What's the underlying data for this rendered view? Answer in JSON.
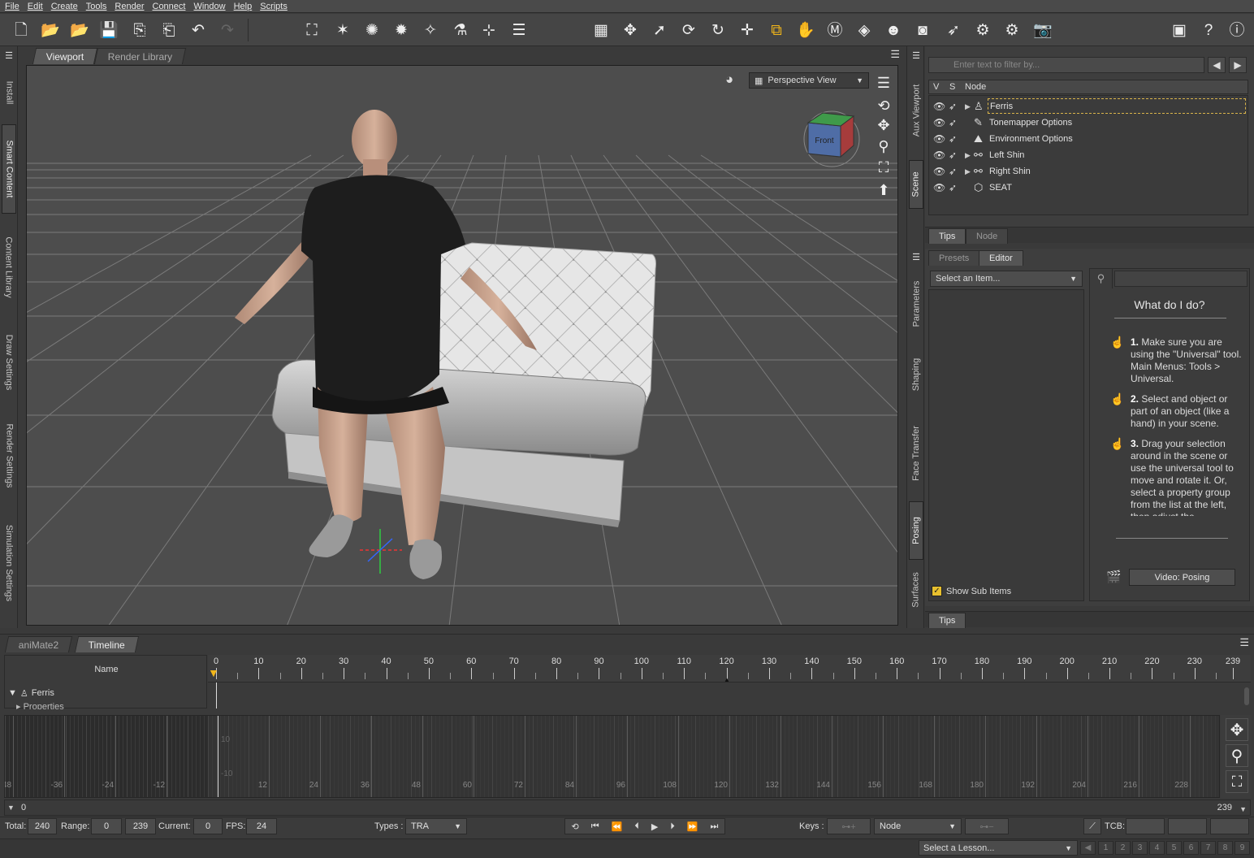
{
  "menubar": {
    "items": [
      "File",
      "Edit",
      "Create",
      "Tools",
      "Render",
      "Connect",
      "Window",
      "Help",
      "Scripts"
    ]
  },
  "toolbar": {
    "file_icons": [
      "new-scene-icon",
      "open-icon",
      "merge-icon",
      "save-icon",
      "import-icon",
      "export-icon",
      "undo-icon",
      "redo-icon"
    ],
    "create_icons": [
      "create-figure-icon",
      "spotlight-icon",
      "point-light-icon",
      "distant-light-icon",
      "camera-light-icon",
      "joint-editor-icon",
      "node-weight-icon",
      "menu-list-icon"
    ],
    "tool_icons": [
      "region-nav-icon",
      "universal-tool-icon",
      "node-select-icon",
      "rotate-icon",
      "rotate-circle-icon",
      "translate-icon",
      "scale-icon",
      "active-pose-icon",
      "morph-icon",
      "surface-selection-icon",
      "geometry-editor-icon",
      "figure-setup-icon",
      "camera-render-icon",
      "select-icon",
      "render-settings-icon",
      "iray-settings-icon",
      "render-icon"
    ],
    "right_icons": [
      "ds-logo-icon",
      "whats-this-icon",
      "help-icon"
    ]
  },
  "left_tabs": [
    "Install",
    "Smart Content",
    "Content Library",
    "Draw Settings",
    "Render Settings",
    "Simulation Settings"
  ],
  "viewport": {
    "tabs": [
      "Viewport",
      "Render Library"
    ],
    "camera": "Perspective View",
    "cube_label": "Front"
  },
  "right_strip_tabs_top": [
    "Aux Viewport",
    "Scene"
  ],
  "right_strip_tabs_bottom": [
    "Parameters",
    "Shaping",
    "Face Transfer",
    "Posing",
    "Surfaces"
  ],
  "scene": {
    "filter_placeholder": "Enter text to filter by...",
    "headers": {
      "v": "V",
      "s": "S",
      "node": "Node"
    },
    "nodes": [
      {
        "label": "Ferris",
        "icon": "figure-icon",
        "expandable": true,
        "selected": true
      },
      {
        "label": "Tonemapper Options",
        "icon": "tonemapper-icon",
        "expandable": false
      },
      {
        "label": "Environment Options",
        "icon": "environment-icon",
        "expandable": false
      },
      {
        "label": "Left Shin",
        "icon": "bone-icon",
        "expandable": true
      },
      {
        "label": "Right Shin",
        "icon": "bone-icon",
        "expandable": true
      },
      {
        "label": "SEAT",
        "icon": "prop-icon",
        "expandable": false
      }
    ],
    "tabs": [
      "Tips",
      "Node"
    ]
  },
  "posing": {
    "tabs": [
      "Presets",
      "Editor"
    ],
    "select_placeholder": "Select an Item...",
    "what_title": "What do I do?",
    "steps": [
      {
        "num": "1.",
        "text": "Make sure you are using the \"Universal\" tool. Main Menus: Tools > Universal."
      },
      {
        "num": "2.",
        "text": "Select and object or part of an object (like a hand) in your scene."
      },
      {
        "num": "3.",
        "text": "Drag your selection around in the scene or use the universal tool to move and rotate it. Or, select a property group from the list at the left, then adjust the"
      }
    ],
    "video_button": "Video: Posing",
    "show_sub_items": "Show Sub Items",
    "bottom_tab": "Tips"
  },
  "timeline": {
    "tabs": [
      "aniMate2",
      "Timeline"
    ],
    "name_header": "Name",
    "tree": [
      "Ferris",
      "Properties"
    ],
    "ruler_ticks": [
      "0",
      "10",
      "20",
      "30",
      "40",
      "50",
      "60",
      "70",
      "80",
      "90",
      "100",
      "110",
      "120",
      "130",
      "140",
      "150",
      "160",
      "170",
      "180",
      "190",
      "200",
      "210",
      "220",
      "230",
      "239"
    ],
    "graph_ticks": [
      "-48",
      "-36",
      "-24",
      "-12",
      "12",
      "24",
      "36",
      "48",
      "60",
      "72",
      "84",
      "96",
      "108",
      "120",
      "132",
      "144",
      "156",
      "168",
      "180",
      "192",
      "204",
      "216",
      "228"
    ],
    "graph_y": [
      "10",
      "-10"
    ],
    "scrub_start": "0",
    "scrub_end": "239",
    "total_label": "Total:",
    "total": "240",
    "range_label": "Range:",
    "range_start": "0",
    "range_end": "239",
    "current_label": "Current:",
    "current": "0",
    "fps_label": "FPS:",
    "fps": "24",
    "types_label": "Types :",
    "types": "TRA",
    "keys_label": "Keys :",
    "keys_mode": "Node",
    "tcb_label": "TCB:"
  },
  "lesson": {
    "placeholder": "Select a Lesson...",
    "numbers": [
      "1",
      "2",
      "3",
      "4",
      "5",
      "6",
      "7",
      "8",
      "9"
    ]
  },
  "colors": {
    "accent": "#f2b619",
    "bg": "#3a3a3a",
    "viewport": "#4d4d4d"
  }
}
